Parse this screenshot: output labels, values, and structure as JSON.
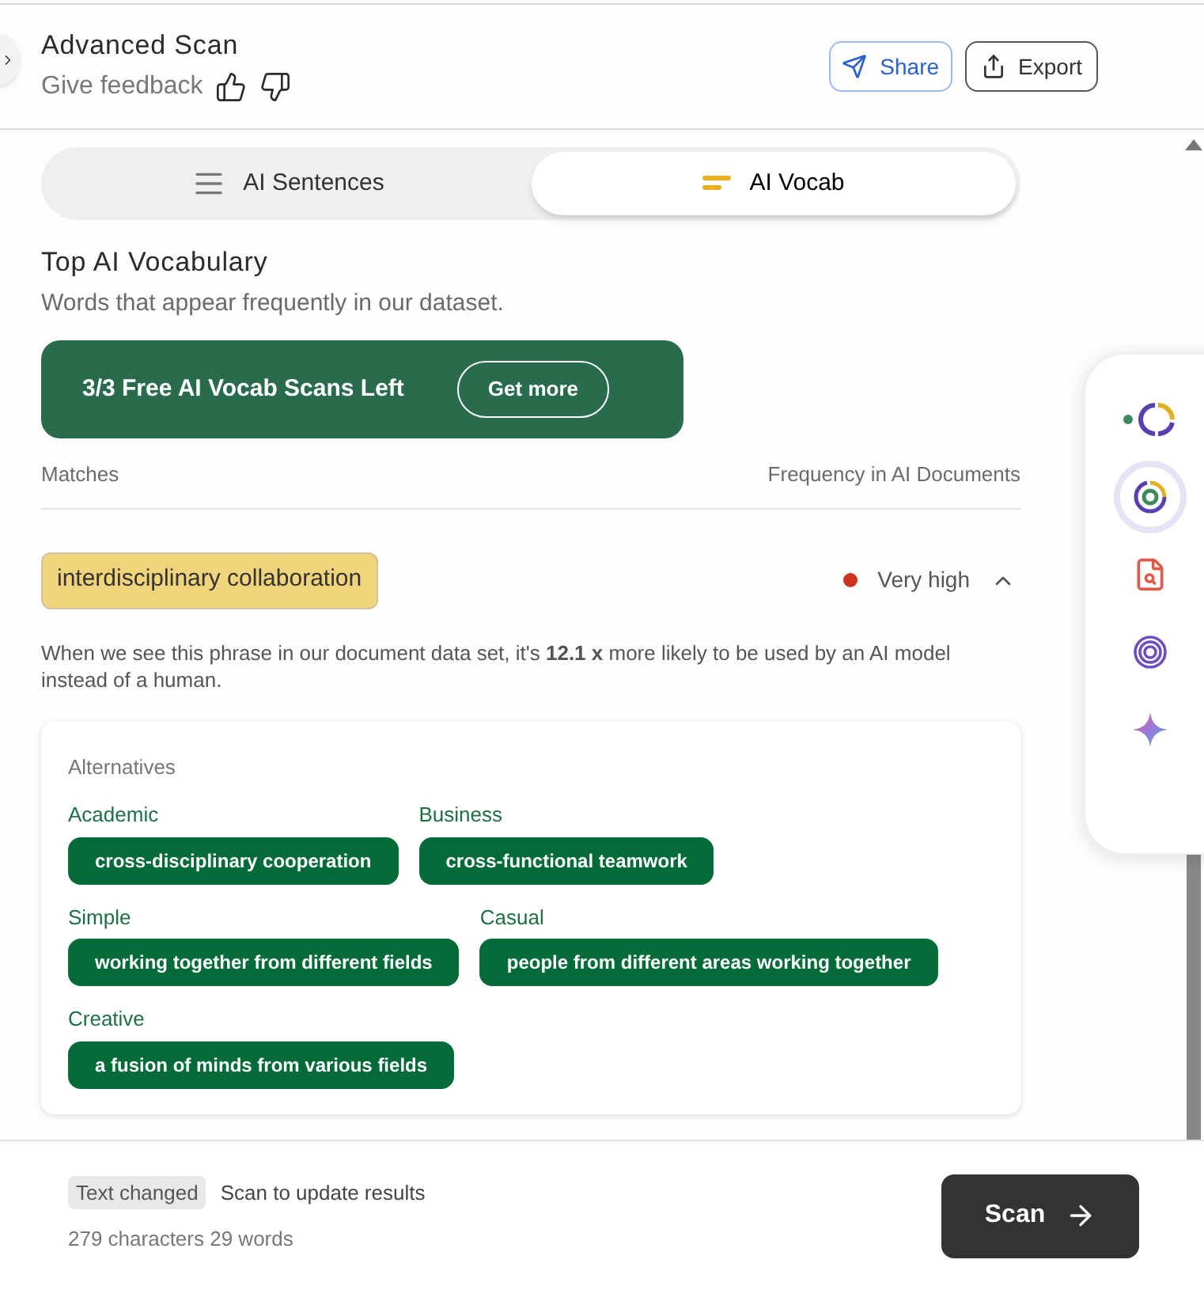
{
  "header": {
    "title": "Advanced Scan",
    "feedback": "Give feedback",
    "buttons": [
      {
        "kind": "share",
        "label": "Share"
      },
      {
        "kind": "export",
        "label": "Export"
      }
    ]
  },
  "tabs": [
    {
      "kind": "sentences",
      "label": "AI Sentences",
      "selected": false
    },
    {
      "kind": "vocab",
      "label": "AI Vocab",
      "selected": true
    }
  ],
  "section": {
    "title": "Top AI Vocabulary",
    "subtitle": "Words that appear frequently in our dataset."
  },
  "banner": {
    "text": "3/3 Free AI Vocab Scans Left",
    "button": "Get more"
  },
  "columns": [
    "Matches",
    "Frequency in AI Documents"
  ],
  "match": {
    "phrase": "interdisciplinary collaboration",
    "frequency": "Very high",
    "color": "#d0311f",
    "expanded": true,
    "description": "When we see this phrase in our document data set, it's **12.1 x** more likely to be used by an AI model instead of a human.",
    "alternatives_title": "Alternatives",
    "alternative_rows": [
      [
        {
          "label": "Academic",
          "text": "cross-disciplinary cooperation"
        },
        {
          "label": "Business",
          "text": "cross-functional teamwork"
        }
      ],
      [
        {
          "label": "Simple",
          "text": "working together from different fields"
        },
        {
          "label": "Casual",
          "text": "people from different areas working together"
        }
      ],
      [
        {
          "label": "Creative",
          "text": "a fusion of minds from various fields"
        }
      ]
    ]
  },
  "side_tools": [
    {
      "kind": "ring",
      "selected": false
    },
    {
      "kind": "target",
      "selected": true
    },
    {
      "kind": "document",
      "selected": false
    },
    {
      "kind": "spiral",
      "selected": false
    },
    {
      "kind": "sparkle",
      "selected": false
    }
  ],
  "footer": {
    "badge": "Text changed",
    "hint": "Scan to update results",
    "counts": "279 characters 29 words",
    "button": "Scan"
  }
}
